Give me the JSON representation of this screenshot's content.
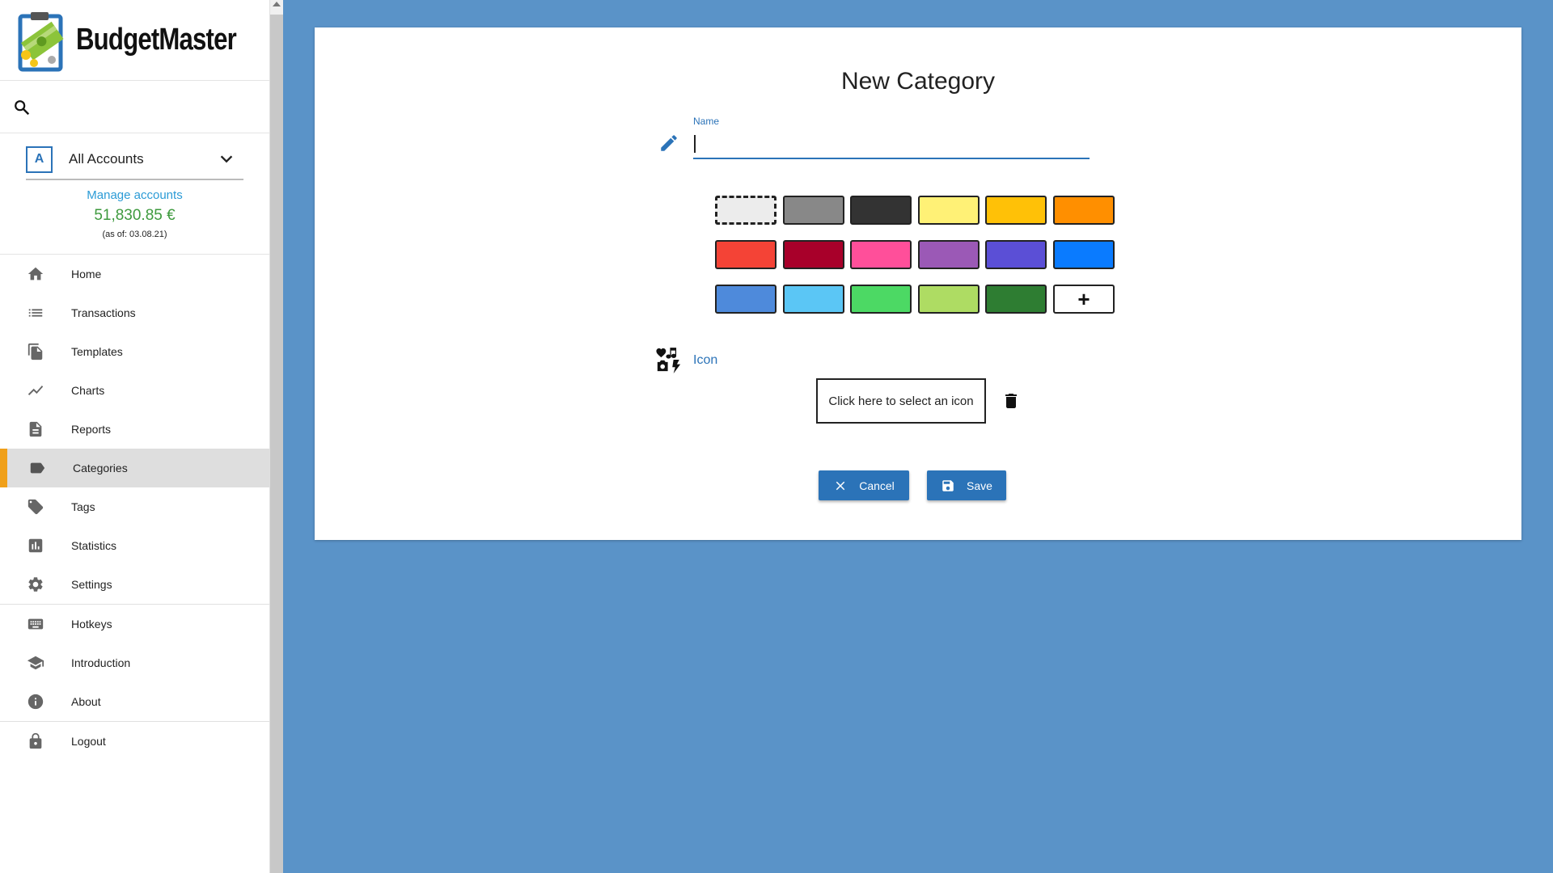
{
  "app": {
    "title": "BudgetMaster"
  },
  "account": {
    "badge": "A",
    "selected": "All Accounts",
    "manage_label": "Manage accounts",
    "balance": "51,830.85 €",
    "as_of": "(as of: 03.08.21)"
  },
  "nav": {
    "items": [
      {
        "label": "Home",
        "icon": "home-icon"
      },
      {
        "label": "Transactions",
        "icon": "list-icon"
      },
      {
        "label": "Templates",
        "icon": "file-copy-icon"
      },
      {
        "label": "Charts",
        "icon": "show-chart-icon"
      },
      {
        "label": "Reports",
        "icon": "description-icon"
      },
      {
        "label": "Categories",
        "icon": "label-icon"
      },
      {
        "label": "Tags",
        "icon": "local-offer-icon"
      },
      {
        "label": "Statistics",
        "icon": "insert-chart-icon"
      },
      {
        "label": "Settings",
        "icon": "settings-icon"
      },
      {
        "label": "Hotkeys",
        "icon": "keyboard-icon"
      },
      {
        "label": "Introduction",
        "icon": "school-icon"
      },
      {
        "label": "About",
        "icon": "info-icon"
      },
      {
        "label": "Logout",
        "icon": "lock-icon"
      }
    ],
    "active": "Categories"
  },
  "form": {
    "title": "New Category",
    "name_label": "Name",
    "name_value": "",
    "icon_label": "Icon",
    "icon_select_text": "Click here to select an icon",
    "cancel_label": "Cancel",
    "save_label": "Save",
    "add_color_label": "+"
  },
  "colors": {
    "row1": [
      "none",
      "#888888",
      "#333333",
      "#FFF176",
      "#FFC107",
      "#FF8F00"
    ],
    "row2": [
      "#F44336",
      "#A8002A",
      "#FF4F9A",
      "#9B59B6",
      "#5B4FD6",
      "#0A7BFF"
    ],
    "row3": [
      "#4E8ADB",
      "#5BC6F5",
      "#4CD964",
      "#AEDC63",
      "#2E7D32",
      "add"
    ],
    "accent": "#2B73B8",
    "nav_active_marker": "#F0A01A",
    "balance_color": "#3E9A3E"
  }
}
